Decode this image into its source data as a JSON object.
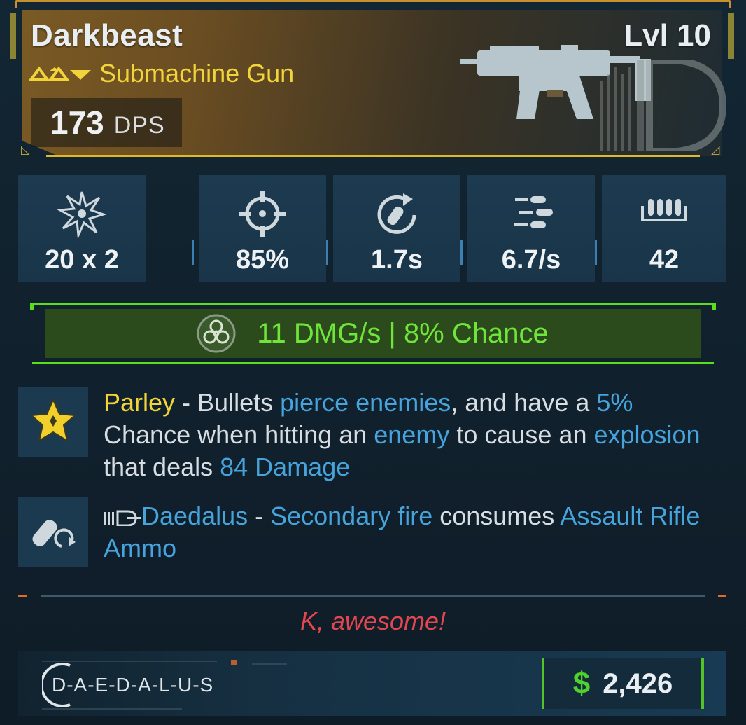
{
  "weapon": {
    "name": "Darkbeast",
    "level": "Lvl 10",
    "type": "Submachine Gun",
    "dps_value": "173",
    "dps_unit": "DPS",
    "rarity_tiers": 3
  },
  "stats": [
    {
      "icon": "damage-burst-icon",
      "value": "20 x 2"
    },
    {
      "icon": "crosshair-icon",
      "value": "85%"
    },
    {
      "icon": "reload-icon",
      "value": "1.7s"
    },
    {
      "icon": "fire-rate-bullets-icon",
      "value": "6.7/s"
    },
    {
      "icon": "magazine-icon",
      "value": "42"
    }
  ],
  "effect": {
    "icon": "biohazard-icon",
    "text": "11 DMG/s | 8% Chance",
    "color": "#58e11b"
  },
  "perks": [
    {
      "icon": "star-perk-icon",
      "name": "Parley",
      "segments": [
        {
          "t": " - Bullets ",
          "hl": false
        },
        {
          "t": "pierce enemies",
          "hl": true
        },
        {
          "t": ", and have a ",
          "hl": false
        },
        {
          "t": "5%",
          "hl": true
        },
        {
          "t": " Chance when hitting an ",
          "hl": false
        },
        {
          "t": "enemy",
          "hl": true
        },
        {
          "t": " to cause an ",
          "hl": false
        },
        {
          "t": "explosion",
          "hl": true
        },
        {
          "t": " that deals ",
          "hl": false
        },
        {
          "t": "84 Damage",
          "hl": true
        }
      ]
    },
    {
      "icon": "ammo-swap-icon",
      "prefix_icon": "daedalus-brand-icon",
      "name": "Daedalus",
      "segments": [
        {
          "t": " - ",
          "hl": false
        },
        {
          "t": "Secondary fire",
          "hl": true
        },
        {
          "t": " consumes ",
          "hl": false
        },
        {
          "t": "Assault Rifle Ammo",
          "hl": true
        }
      ]
    }
  ],
  "quip": "K, awesome!",
  "footer": {
    "manufacturer": "D-A-E-D-A-L-U-S",
    "currency_icon": "dollar-icon",
    "currency_symbol": "$",
    "price": "2,426"
  },
  "colors": {
    "accent_gold": "#c8902c",
    "rarity_yellow": "#f1d33a",
    "highlight_blue": "#46a3dc",
    "effect_green": "#58e11b",
    "quip_red": "#e2474f"
  }
}
